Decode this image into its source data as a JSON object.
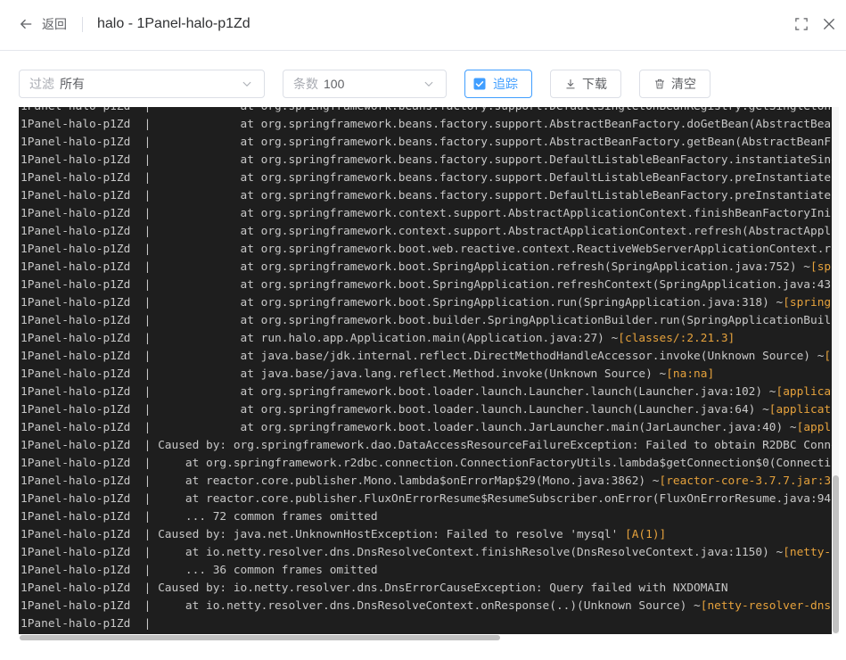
{
  "header": {
    "back_label": "返回",
    "title": "halo - 1Panel-halo-p1Zd",
    "icons": {
      "back": "back-arrow-icon",
      "fullscreen": "fullscreen-icon",
      "close": "close-icon"
    }
  },
  "toolbar": {
    "filter": {
      "label": "过滤",
      "value": "所有",
      "icon": "chevron-down-icon"
    },
    "count": {
      "label": "条数",
      "value": "100",
      "icon": "chevron-down-icon"
    },
    "follow": {
      "label": "追踪",
      "checked": true,
      "icon": "checkbox-checked-icon"
    },
    "download": {
      "label": "下载",
      "icon": "download-icon"
    },
    "clear": {
      "label": "清空",
      "icon": "trash-icon"
    }
  },
  "colors": {
    "accent": "#409eff",
    "log_background": "#1e1e1e",
    "log_text": "#c8c8c8",
    "log_highlight": "#e6a23c"
  },
  "log": {
    "lines": [
      {
        "text": "1Panel-halo-p1Zd  |             at org.springframework.beans.factory.support.DefaultSingletonBeanRegistry.getSingleton"
      },
      {
        "text": "1Panel-halo-p1Zd  |             at org.springframework.beans.factory.support.AbstractBeanFactory.doGetBean(AbstractBean"
      },
      {
        "text": "1Panel-halo-p1Zd  |             at org.springframework.beans.factory.support.AbstractBeanFactory.getBean(AbstractBeanF"
      },
      {
        "text": "1Panel-halo-p1Zd  |             at org.springframework.beans.factory.support.DefaultListableBeanFactory.instantiateSing"
      },
      {
        "text": "1Panel-halo-p1Zd  |             at org.springframework.beans.factory.support.DefaultListableBeanFactory.preInstantiate"
      },
      {
        "text": "1Panel-halo-p1Zd  |             at org.springframework.beans.factory.support.DefaultListableBeanFactory.preInstantiate"
      },
      {
        "text": "1Panel-halo-p1Zd  |             at org.springframework.context.support.AbstractApplicationContext.finishBeanFactoryIni"
      },
      {
        "text": "1Panel-halo-p1Zd  |             at org.springframework.context.support.AbstractApplicationContext.refresh(AbstractAppl"
      },
      {
        "text": "1Panel-halo-p1Zd  |             at org.springframework.boot.web.reactive.context.ReactiveWebServerApplicationContext.re"
      },
      {
        "text": "1Panel-halo-p1Zd  |             at org.springframework.boot.SpringApplication.refresh(SpringApplication.java:752) ~",
        "highlight": "[sp"
      },
      {
        "text": "1Panel-halo-p1Zd  |             at org.springframework.boot.SpringApplication.refreshContext(SpringApplication.java:43"
      },
      {
        "text": "1Panel-halo-p1Zd  |             at org.springframework.boot.SpringApplication.run(SpringApplication.java:318) ~",
        "highlight": "[spring"
      },
      {
        "text": "1Panel-halo-p1Zd  |             at org.springframework.boot.builder.SpringApplicationBuilder.run(SpringApplicationBuil"
      },
      {
        "text": "1Panel-halo-p1Zd  |             at run.halo.app.Application.main(Application.java:27) ~",
        "highlight": "[classes/:2.21.3]"
      },
      {
        "text": "1Panel-halo-p1Zd  |             at java.base/jdk.internal.reflect.DirectMethodHandleAccessor.invoke(Unknown Source) ~",
        "highlight": "["
      },
      {
        "text": "1Panel-halo-p1Zd  |             at java.base/java.lang.reflect.Method.invoke(Unknown Source) ~",
        "highlight": "[na:na]"
      },
      {
        "text": "1Panel-halo-p1Zd  |             at org.springframework.boot.loader.launch.Launcher.launch(Launcher.java:102) ~",
        "highlight": "[applicat"
      },
      {
        "text": "1Panel-halo-p1Zd  |             at org.springframework.boot.loader.launch.Launcher.launch(Launcher.java:64) ~",
        "highlight": "[applicat"
      },
      {
        "text": "1Panel-halo-p1Zd  |             at org.springframework.boot.loader.launch.JarLauncher.main(JarLauncher.java:40) ~",
        "highlight": "[appl"
      },
      {
        "text": "1Panel-halo-p1Zd  | Caused by: org.springframework.dao.DataAccessResourceFailureException: Failed to obtain R2DBC Conne"
      },
      {
        "text": "1Panel-halo-p1Zd  |     at org.springframework.r2dbc.connection.ConnectionFactoryUtils.lambda$getConnection$0(Connectio"
      },
      {
        "text": "1Panel-halo-p1Zd  |     at reactor.core.publisher.Mono.lambda$onErrorMap$29(Mono.java:3862) ~",
        "highlight": "[reactor-core-3.7.7.jar:3"
      },
      {
        "text": "1Panel-halo-p1Zd  |     at reactor.core.publisher.FluxOnErrorResume$ResumeSubscriber.onError(FluxOnErrorResume.java:94"
      },
      {
        "text": "1Panel-halo-p1Zd  |     ... 72 common frames omitted"
      },
      {
        "text": "1Panel-halo-p1Zd  | Caused by: java.net.UnknownHostException: Failed to resolve 'mysql' ",
        "highlight": "[A(1)]"
      },
      {
        "text": "1Panel-halo-p1Zd  |     at io.netty.resolver.dns.DnsResolveContext.finishResolve(DnsResolveContext.java:1150) ~",
        "highlight": "[netty-"
      },
      {
        "text": "1Panel-halo-p1Zd  |     ... 36 common frames omitted"
      },
      {
        "text": "1Panel-halo-p1Zd  | Caused by: io.netty.resolver.dns.DnsErrorCauseException: Query failed with NXDOMAIN"
      },
      {
        "text": "1Panel-halo-p1Zd  |     at io.netty.resolver.dns.DnsResolveContext.onResponse(..)(Unknown Source) ~",
        "highlight": "[netty-resolver-dns"
      },
      {
        "text": "1Panel-halo-p1Zd  |"
      }
    ]
  }
}
